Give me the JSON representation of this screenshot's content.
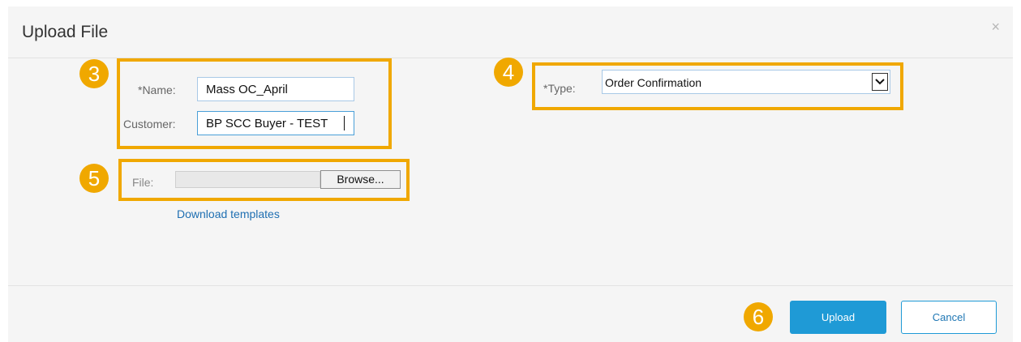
{
  "dialog": {
    "title": "Upload File",
    "close_glyph": "×"
  },
  "steps": [
    "3",
    "4",
    "5",
    "6"
  ],
  "form": {
    "name_label": "*Name:",
    "name_value": "Mass OC_April",
    "customer_label": "Customer:",
    "customer_value": "BP SCC Buyer - TEST",
    "type_label": "*Type:",
    "type_value": "Order Confirmation",
    "file_label": "File:",
    "browse_label": "Browse...",
    "download_link": "Download templates"
  },
  "footer": {
    "upload_label": "Upload",
    "cancel_label": "Cancel"
  },
  "colors": {
    "highlight": "#f0a800",
    "primary": "#1f9ad6",
    "link": "#1f6fb2"
  },
  "icons": {
    "close": "close-icon",
    "dropdown": "chevron-down-icon"
  }
}
